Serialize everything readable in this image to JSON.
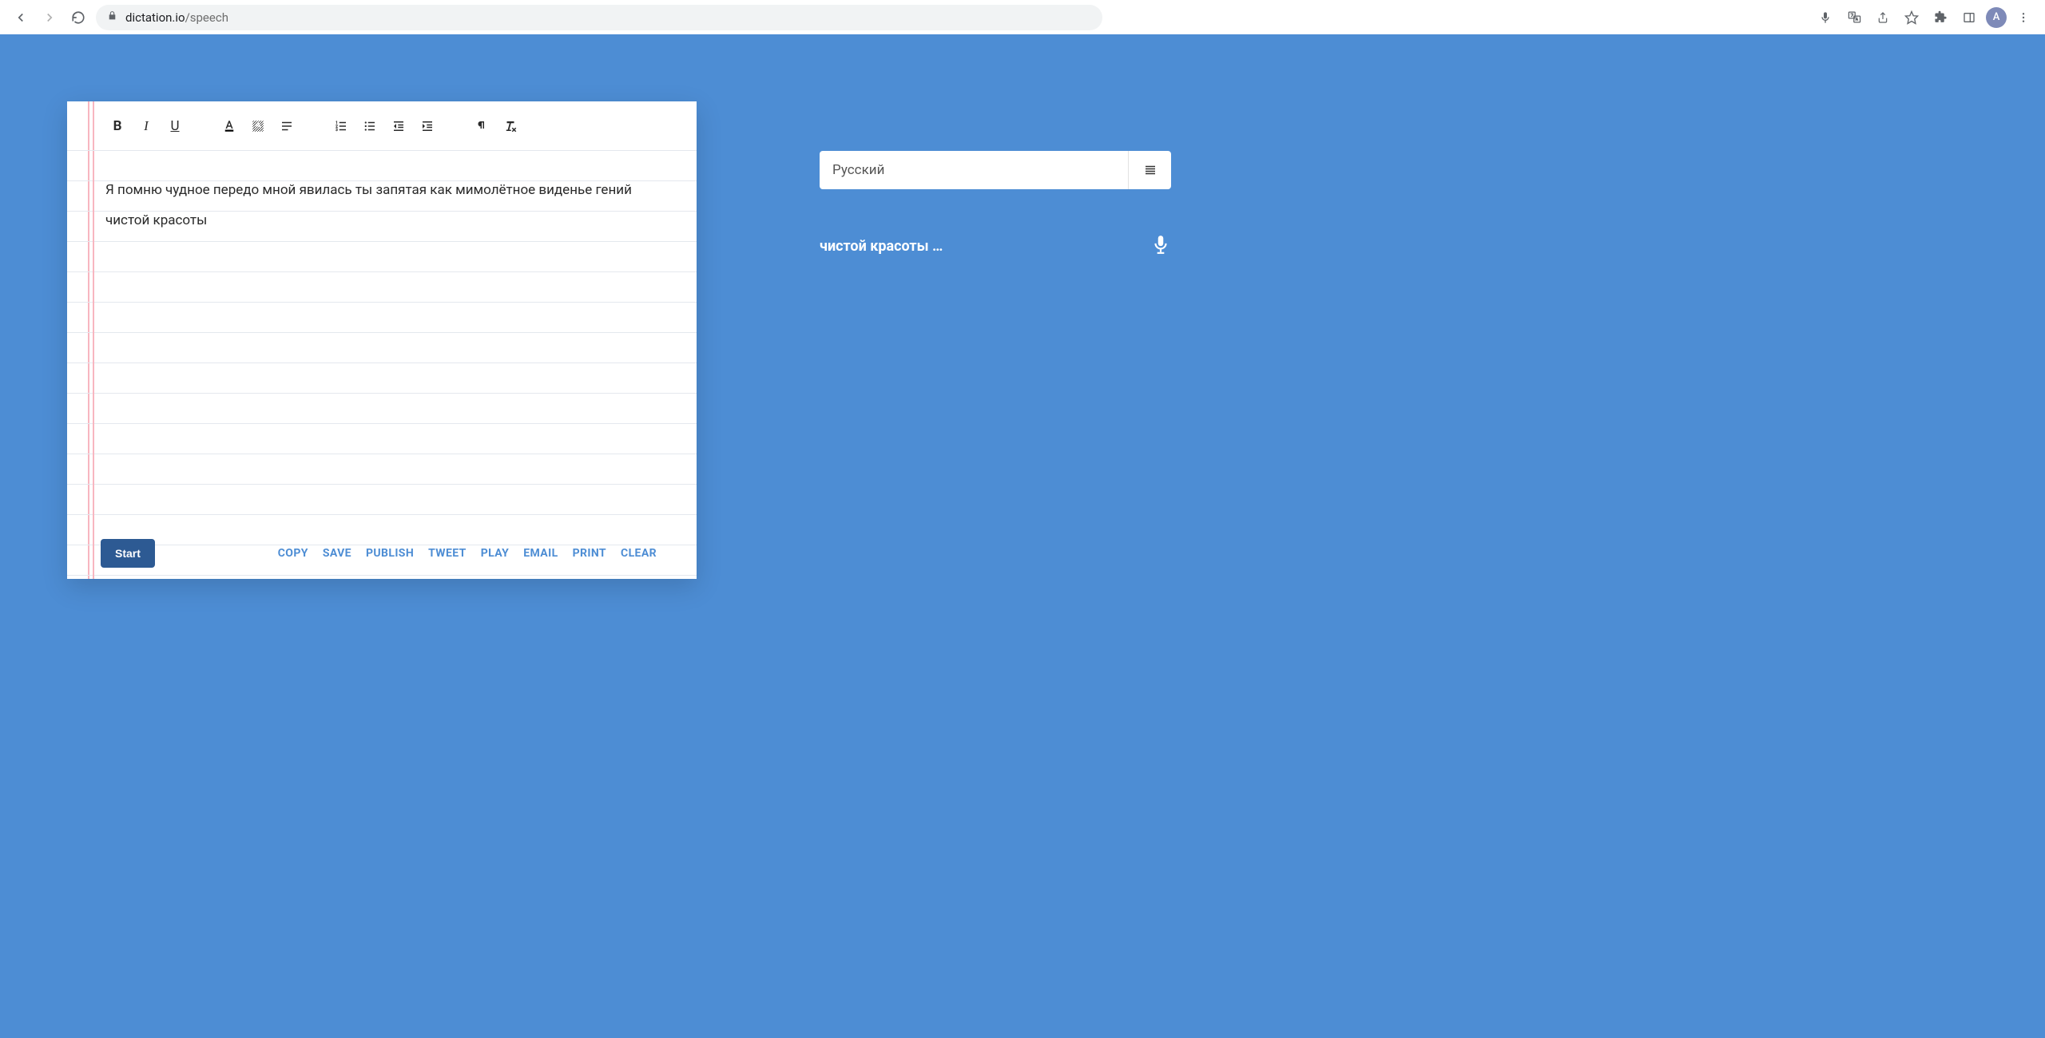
{
  "browser": {
    "url_host": "dictation.io",
    "url_path": "/speech",
    "avatar_initial": "A"
  },
  "editor": {
    "text": "Я помню чудное передо мной явилась ты запятая как мимолётное виденье гений чистой красоты"
  },
  "footer": {
    "start": "Start",
    "actions": {
      "copy": "COPY",
      "save": "SAVE",
      "publish": "PUBLISH",
      "tweet": "TWEET",
      "play": "PLAY",
      "email": "EMAIL",
      "print": "PRINT",
      "clear": "CLEAR"
    }
  },
  "right": {
    "language": "Русский",
    "transcript": "чистой красоты …"
  }
}
